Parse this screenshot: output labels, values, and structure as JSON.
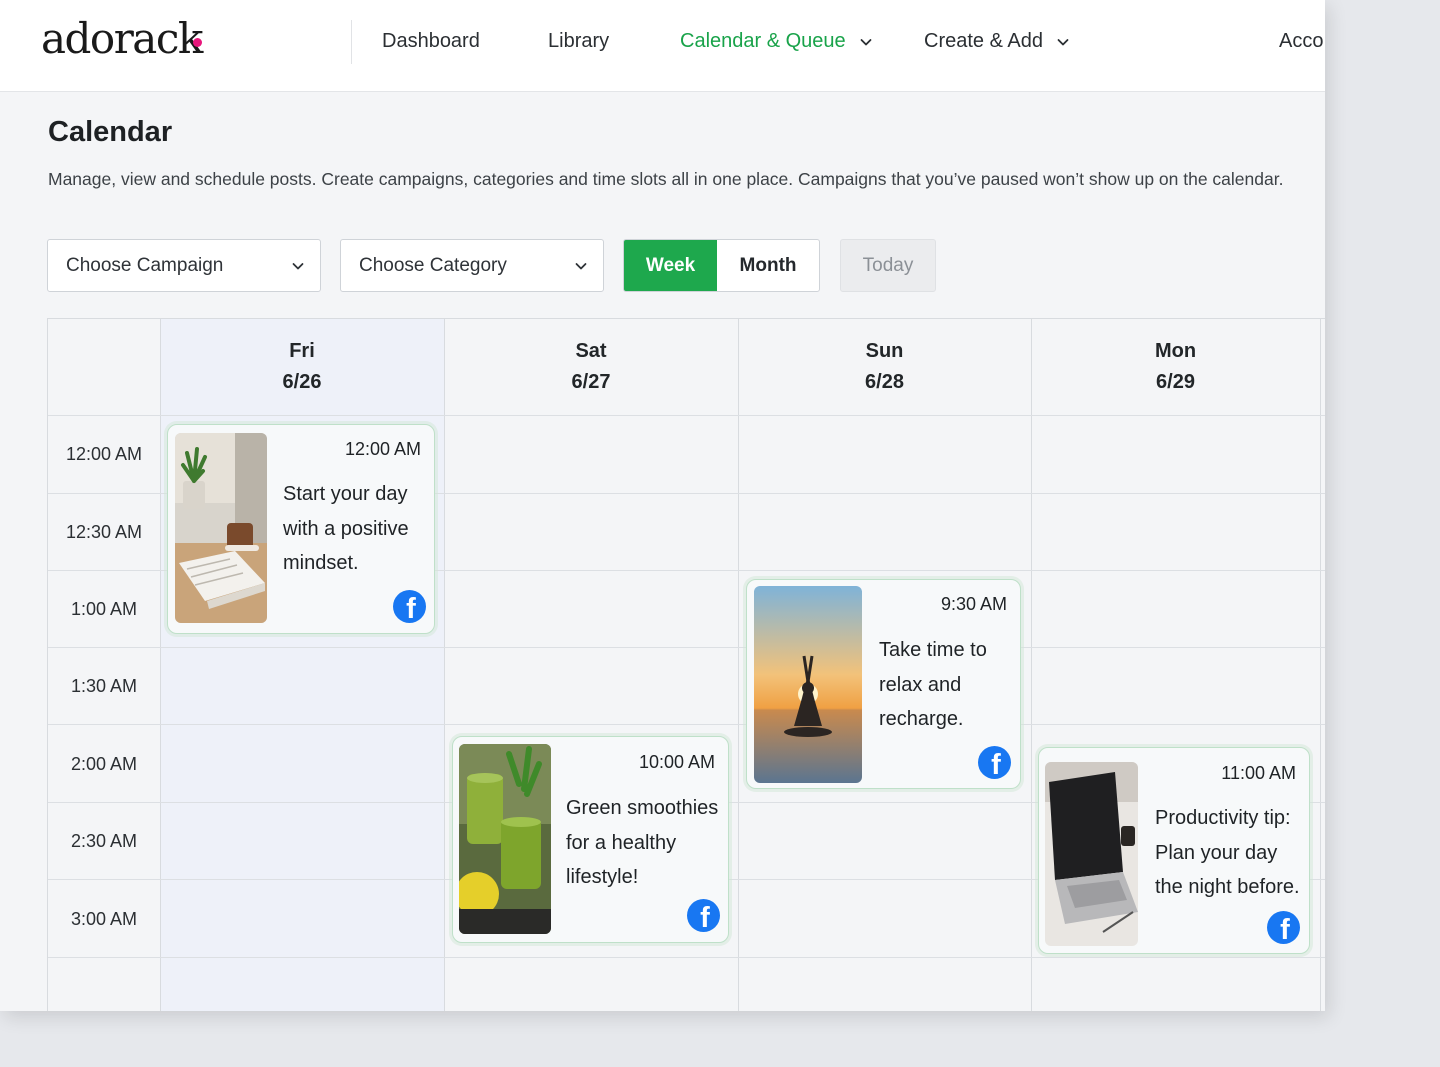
{
  "brand": {
    "logo": "adorack",
    "dot_color": "#e8177c"
  },
  "nav": {
    "items": [
      {
        "label": "Dashboard"
      },
      {
        "label": "Library"
      },
      {
        "label": "Calendar & Queue",
        "active": true,
        "has_dropdown": true
      },
      {
        "label": "Create & Add",
        "has_dropdown": true
      },
      {
        "label": "Acco"
      }
    ]
  },
  "page": {
    "title": "Calendar",
    "description": "Manage, view and schedule posts. Create campaigns, categories and time slots all in one place. Campaigns that you’ve paused won’t show up on the calendar."
  },
  "filters": {
    "campaign_placeholder": "Choose Campaign",
    "category_placeholder": "Choose Category"
  },
  "view_toggle": {
    "week": "Week",
    "month": "Month",
    "selected": "Week",
    "today": "Today"
  },
  "calendar": {
    "days": [
      {
        "name": "Fri",
        "date": "6/26",
        "highlighted": true
      },
      {
        "name": "Sat",
        "date": "6/27"
      },
      {
        "name": "Sun",
        "date": "6/28"
      },
      {
        "name": "Mon",
        "date": "6/29"
      }
    ],
    "times": [
      "12:00 AM",
      "12:30 AM",
      "1:00 AM",
      "1:30 AM",
      "2:00 AM",
      "2:30 AM",
      "3:00 AM"
    ],
    "posts": [
      {
        "day": "Fri",
        "time": "12:00 AM",
        "text": "Start your day with a positive mindset.",
        "lines": [
          "Start your day",
          "with a positive",
          "mindset."
        ],
        "network": "facebook-icon",
        "image": "coffee-book-plant"
      },
      {
        "day": "Sat",
        "time": "10:00 AM",
        "text": "Green smoothies for a healthy lifestyle!",
        "lines": [
          "Green smoothies",
          "for a healthy",
          "lifestyle!"
        ],
        "network": "facebook-icon",
        "image": "green-smoothies"
      },
      {
        "day": "Sun",
        "time": "9:30 AM",
        "text": "Take time to relax and recharge.",
        "lines": [
          "Take time to",
          "relax and",
          "recharge."
        ],
        "network": "facebook-icon",
        "image": "yoga-sunset"
      },
      {
        "day": "Mon",
        "time": "11:00 AM",
        "text": "Productivity tip: Plan your day the night before.",
        "lines": [
          "Productivity tip:",
          "Plan your day",
          "the night before."
        ],
        "network": "facebook-icon",
        "image": "laptop-desk"
      }
    ]
  },
  "colors": {
    "accent": "#1ea84d",
    "active_nav": "#19a34a",
    "facebook": "#1877f2",
    "card_border": "#bfe0c9"
  }
}
